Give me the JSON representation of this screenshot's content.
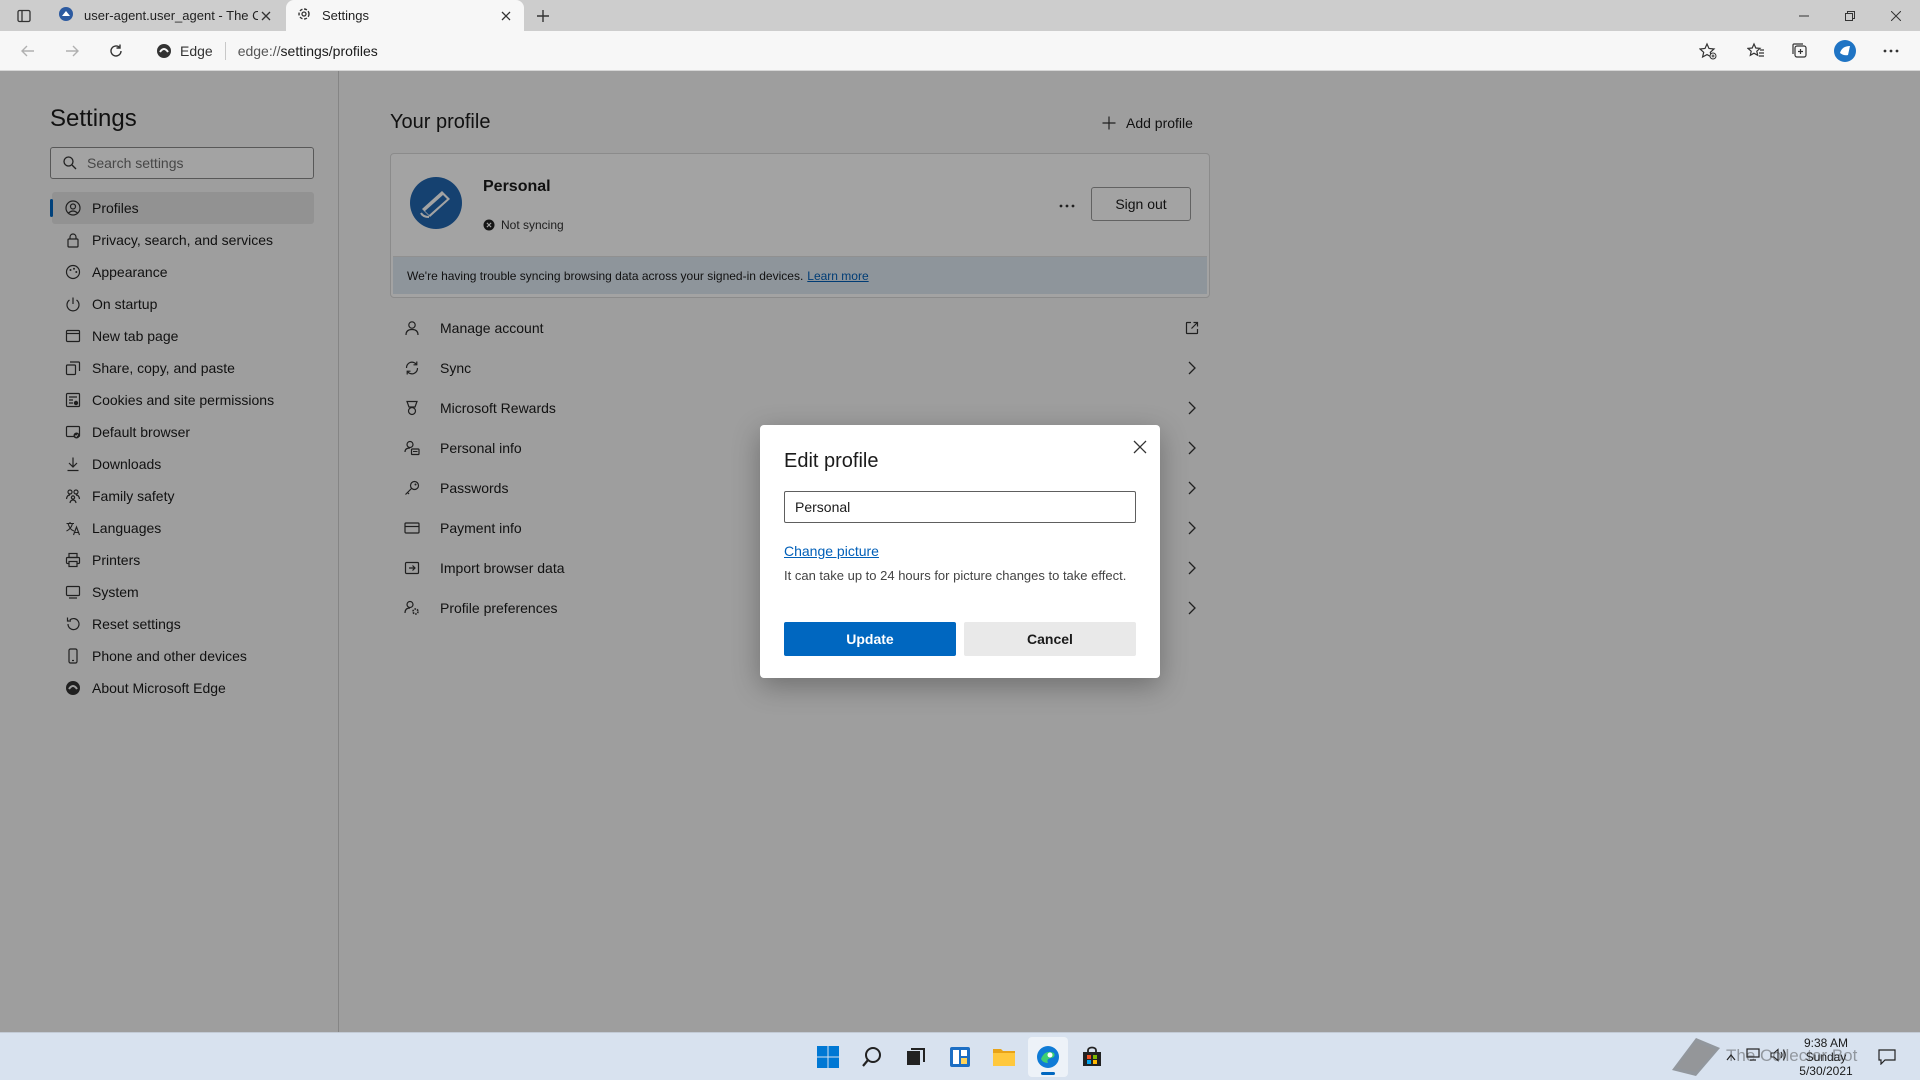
{
  "browser": {
    "tabs": [
      {
        "label": "user-agent.user_agent - The Coll",
        "active": false
      },
      {
        "label": "Settings",
        "active": true
      }
    ],
    "site_label": "Edge",
    "url_prefix": "edge://",
    "url_path": "settings/profiles"
  },
  "sidebar": {
    "title": "Settings",
    "search_placeholder": "Search settings",
    "items": [
      {
        "label": "Profiles",
        "icon": "profile-icon",
        "selected": true
      },
      {
        "label": "Privacy, search, and services",
        "icon": "lock-icon"
      },
      {
        "label": "Appearance",
        "icon": "appearance-icon"
      },
      {
        "label": "On startup",
        "icon": "power-icon"
      },
      {
        "label": "New tab page",
        "icon": "newtab-icon"
      },
      {
        "label": "Share, copy, and paste",
        "icon": "share-icon"
      },
      {
        "label": "Cookies and site permissions",
        "icon": "cookies-icon"
      },
      {
        "label": "Default browser",
        "icon": "browser-icon"
      },
      {
        "label": "Downloads",
        "icon": "download-icon"
      },
      {
        "label": "Family safety",
        "icon": "family-icon"
      },
      {
        "label": "Languages",
        "icon": "language-icon"
      },
      {
        "label": "Printers",
        "icon": "printer-icon"
      },
      {
        "label": "System",
        "icon": "system-icon"
      },
      {
        "label": "Reset settings",
        "icon": "reset-icon"
      },
      {
        "label": "Phone and other devices",
        "icon": "phone-icon"
      },
      {
        "label": "About Microsoft Edge",
        "icon": "edge-icon"
      }
    ]
  },
  "main": {
    "title": "Your profile",
    "add_profile": "Add profile",
    "profile": {
      "name": "Personal",
      "sync_status": "Not syncing",
      "sign_out": "Sign out",
      "banner_text": "We're having trouble syncing browsing data across your signed-in devices.",
      "banner_link": "Learn more"
    },
    "rows": [
      {
        "label": "Manage account",
        "end": "external"
      },
      {
        "label": "Sync",
        "end": "chevron"
      },
      {
        "label": "Microsoft Rewards",
        "end": "chevron"
      },
      {
        "label": "Personal info",
        "end": "chevron"
      },
      {
        "label": "Passwords",
        "end": "chevron"
      },
      {
        "label": "Payment info",
        "end": "chevron"
      },
      {
        "label": "Import browser data",
        "end": "chevron"
      },
      {
        "label": "Profile preferences",
        "end": "chevron"
      }
    ]
  },
  "dialog": {
    "title": "Edit profile",
    "name_value": "Personal",
    "change_picture": "Change picture",
    "hint": "It can take up to 24 hours for picture changes to take effect.",
    "update": "Update",
    "cancel": "Cancel"
  },
  "taskbar": {
    "time": "9:38 AM",
    "day": "Sunday",
    "date": "5/30/2021",
    "watermark": "The Collector Bot"
  },
  "colors": {
    "accent": "#0067c0",
    "link": "#005fb8",
    "banner": "#dfe9f3"
  }
}
